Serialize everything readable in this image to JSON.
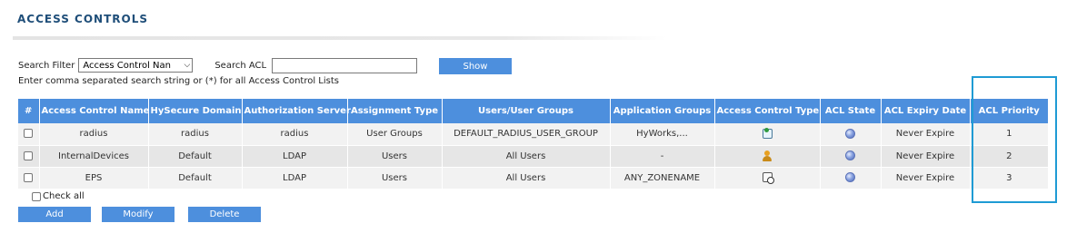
{
  "page": {
    "title": "ACCESS CONTROLS"
  },
  "filter": {
    "search_filter_label": "Search Filter",
    "search_filter_value": "Access Control Nan",
    "search_acl_label": "Search ACL",
    "search_acl_value": "",
    "show_label": "Show",
    "hint": "Enter comma separated search string or (*) for all Access Control Lists"
  },
  "table": {
    "columns": [
      "#",
      "Access Control Name",
      "HySecure Domain",
      "Authorization Server",
      "Assignment Type",
      "Users/User Groups",
      "Application Groups",
      "Access Control Type",
      "ACL State",
      "ACL Expiry Date",
      "ACL Priority"
    ],
    "rows": [
      {
        "name": "radius",
        "domain": "radius",
        "auth_server": "radius",
        "assignment_type": "User Groups",
        "users": "DEFAULT_RADIUS_USER_GROUP",
        "app_groups": "HyWorks,...",
        "type_icon": "user-group-icon",
        "state_icon": "acl-state-active-icon",
        "expiry": "Never Expire",
        "priority": "1"
      },
      {
        "name": "InternalDevices",
        "domain": "Default",
        "auth_server": "LDAP",
        "assignment_type": "Users",
        "users": "All Users",
        "app_groups": "-",
        "type_icon": "user-icon",
        "state_icon": "acl-state-active-icon",
        "expiry": "Never Expire",
        "priority": "2"
      },
      {
        "name": "EPS",
        "domain": "Default",
        "auth_server": "LDAP",
        "assignment_type": "Users",
        "users": "All Users",
        "app_groups": "ANY_ZONENAME",
        "type_icon": "zone-icon",
        "state_icon": "acl-state-active-icon",
        "expiry": "Never Expire",
        "priority": "3"
      }
    ]
  },
  "footer": {
    "check_all_label": "Check all",
    "add_label": "Add",
    "modify_label": "Modify",
    "delete_label": "Delete"
  },
  "colors": {
    "accent": "#4d8fdd",
    "title": "#1f4e79",
    "highlight": "#1f9bd4"
  }
}
